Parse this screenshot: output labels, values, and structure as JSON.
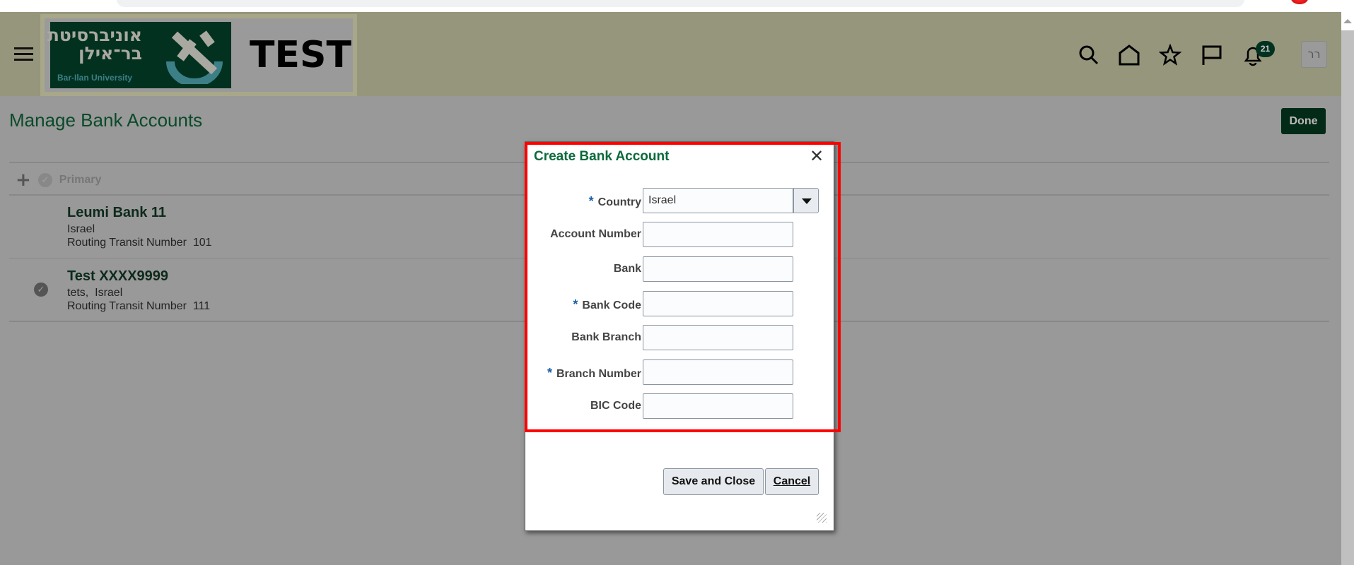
{
  "header": {
    "logo_hebrew": "אוניברסיטת בר־אילן",
    "logo_english": "Bar-Ilan University",
    "env_label": "TEST",
    "notification_count": "21",
    "avatar_initials": "רר"
  },
  "page": {
    "title": "Manage Bank Accounts",
    "done_label": "Done",
    "toolbar": {
      "primary_label": "Primary"
    }
  },
  "accounts": [
    {
      "name": "Leumi Bank 11",
      "line1": "Israel",
      "line2": "Routing Transit Number  101",
      "primary": false
    },
    {
      "name": "Test XXXX9999",
      "line1": "tets,  Israel",
      "line2": "Routing Transit Number  111",
      "primary": true
    }
  ],
  "dialog": {
    "title": "Create Bank Account",
    "fields": [
      {
        "label": "Country",
        "required": true,
        "value": "Israel"
      },
      {
        "label": "Account Number",
        "required": false,
        "value": ""
      },
      {
        "label": "Bank",
        "required": false,
        "value": ""
      },
      {
        "label": "Bank Code",
        "required": true,
        "value": ""
      },
      {
        "label": "Bank Branch",
        "required": false,
        "value": ""
      },
      {
        "label": "Branch Number",
        "required": true,
        "value": ""
      },
      {
        "label": "BIC Code",
        "required": false,
        "value": ""
      }
    ],
    "required_marker": "*",
    "save_label": "Save and Close",
    "cancel_label": "Cancel"
  },
  "colors": {
    "header_bg": "#96967c",
    "accent": "#022a17",
    "highlight": "#ff0000"
  }
}
